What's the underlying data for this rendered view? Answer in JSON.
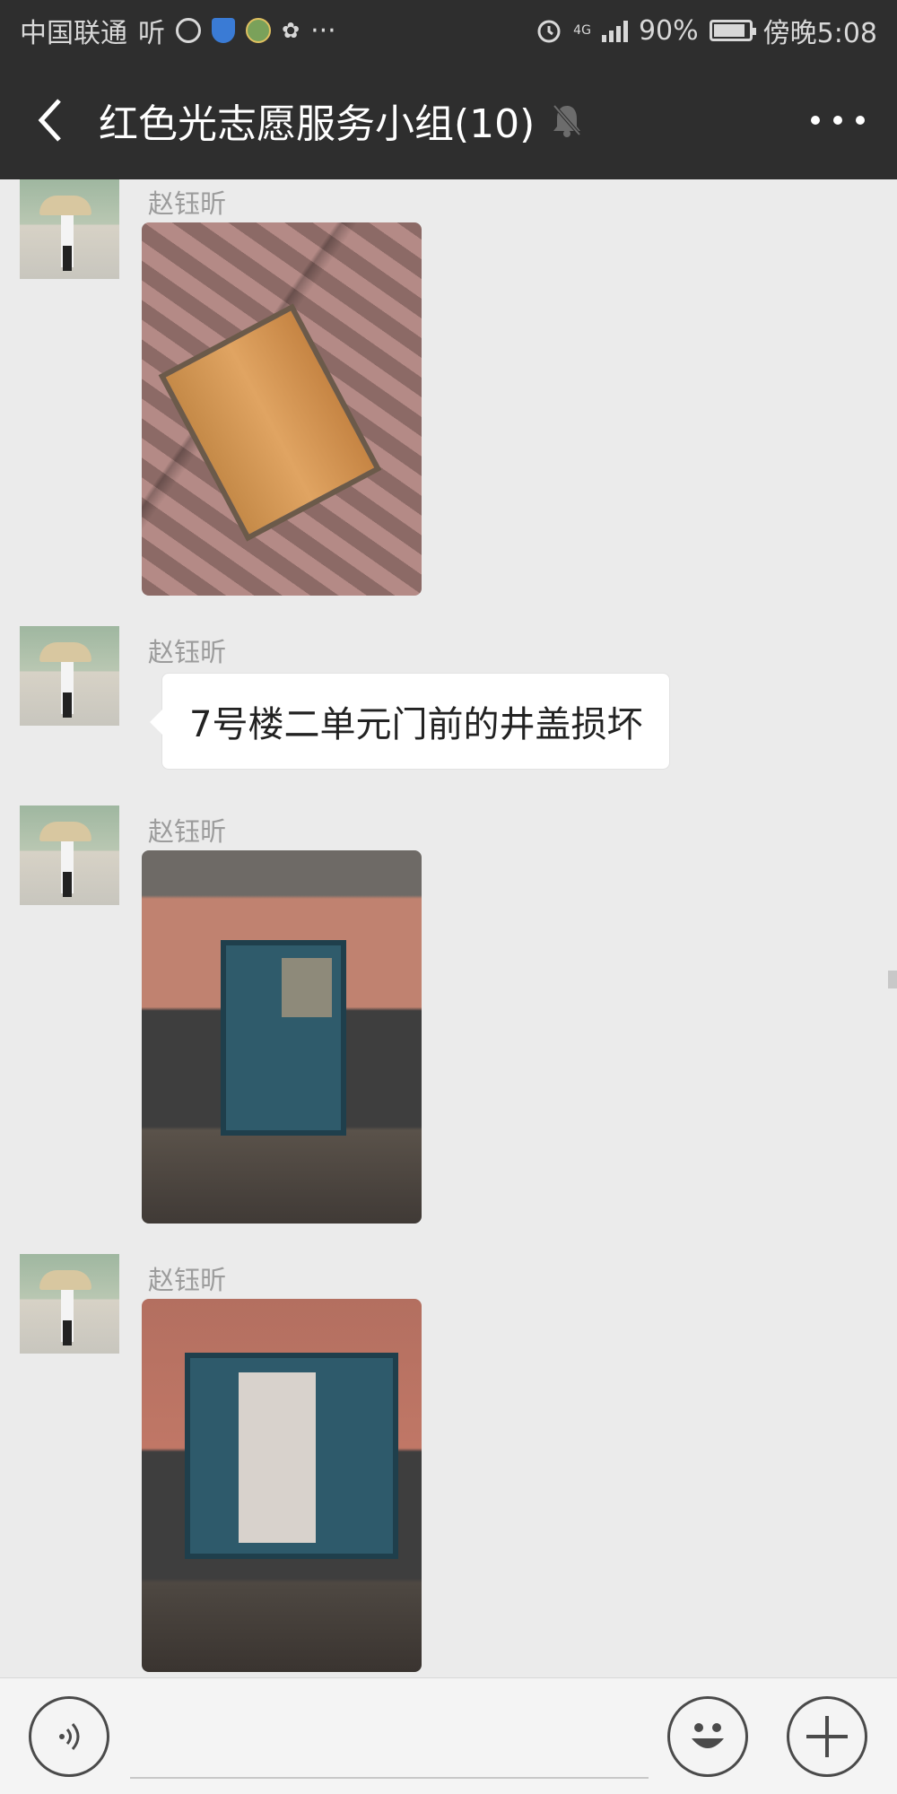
{
  "status_bar": {
    "carrier": "中国联通",
    "carrier_brand": "听",
    "network": "4G",
    "battery": "90%",
    "time": "傍晚5:08",
    "more": "···"
  },
  "nav": {
    "title": "红色光志愿服务小组(10)"
  },
  "messages": [
    {
      "sender": "赵钰昕",
      "type": "image",
      "image": "manhole-photo"
    },
    {
      "sender": "赵钰昕",
      "type": "text",
      "text": "7号楼二单元门前的井盖损坏"
    },
    {
      "sender": "赵钰昕",
      "type": "image",
      "image": "entrance-door-closed-photo"
    },
    {
      "sender": "赵钰昕",
      "type": "image",
      "image": "entrance-door-open-photo"
    }
  ],
  "colors": {
    "header_bg": "#2e2e2e",
    "chat_bg": "#ebebeb",
    "bubble_bg": "#ffffff"
  }
}
